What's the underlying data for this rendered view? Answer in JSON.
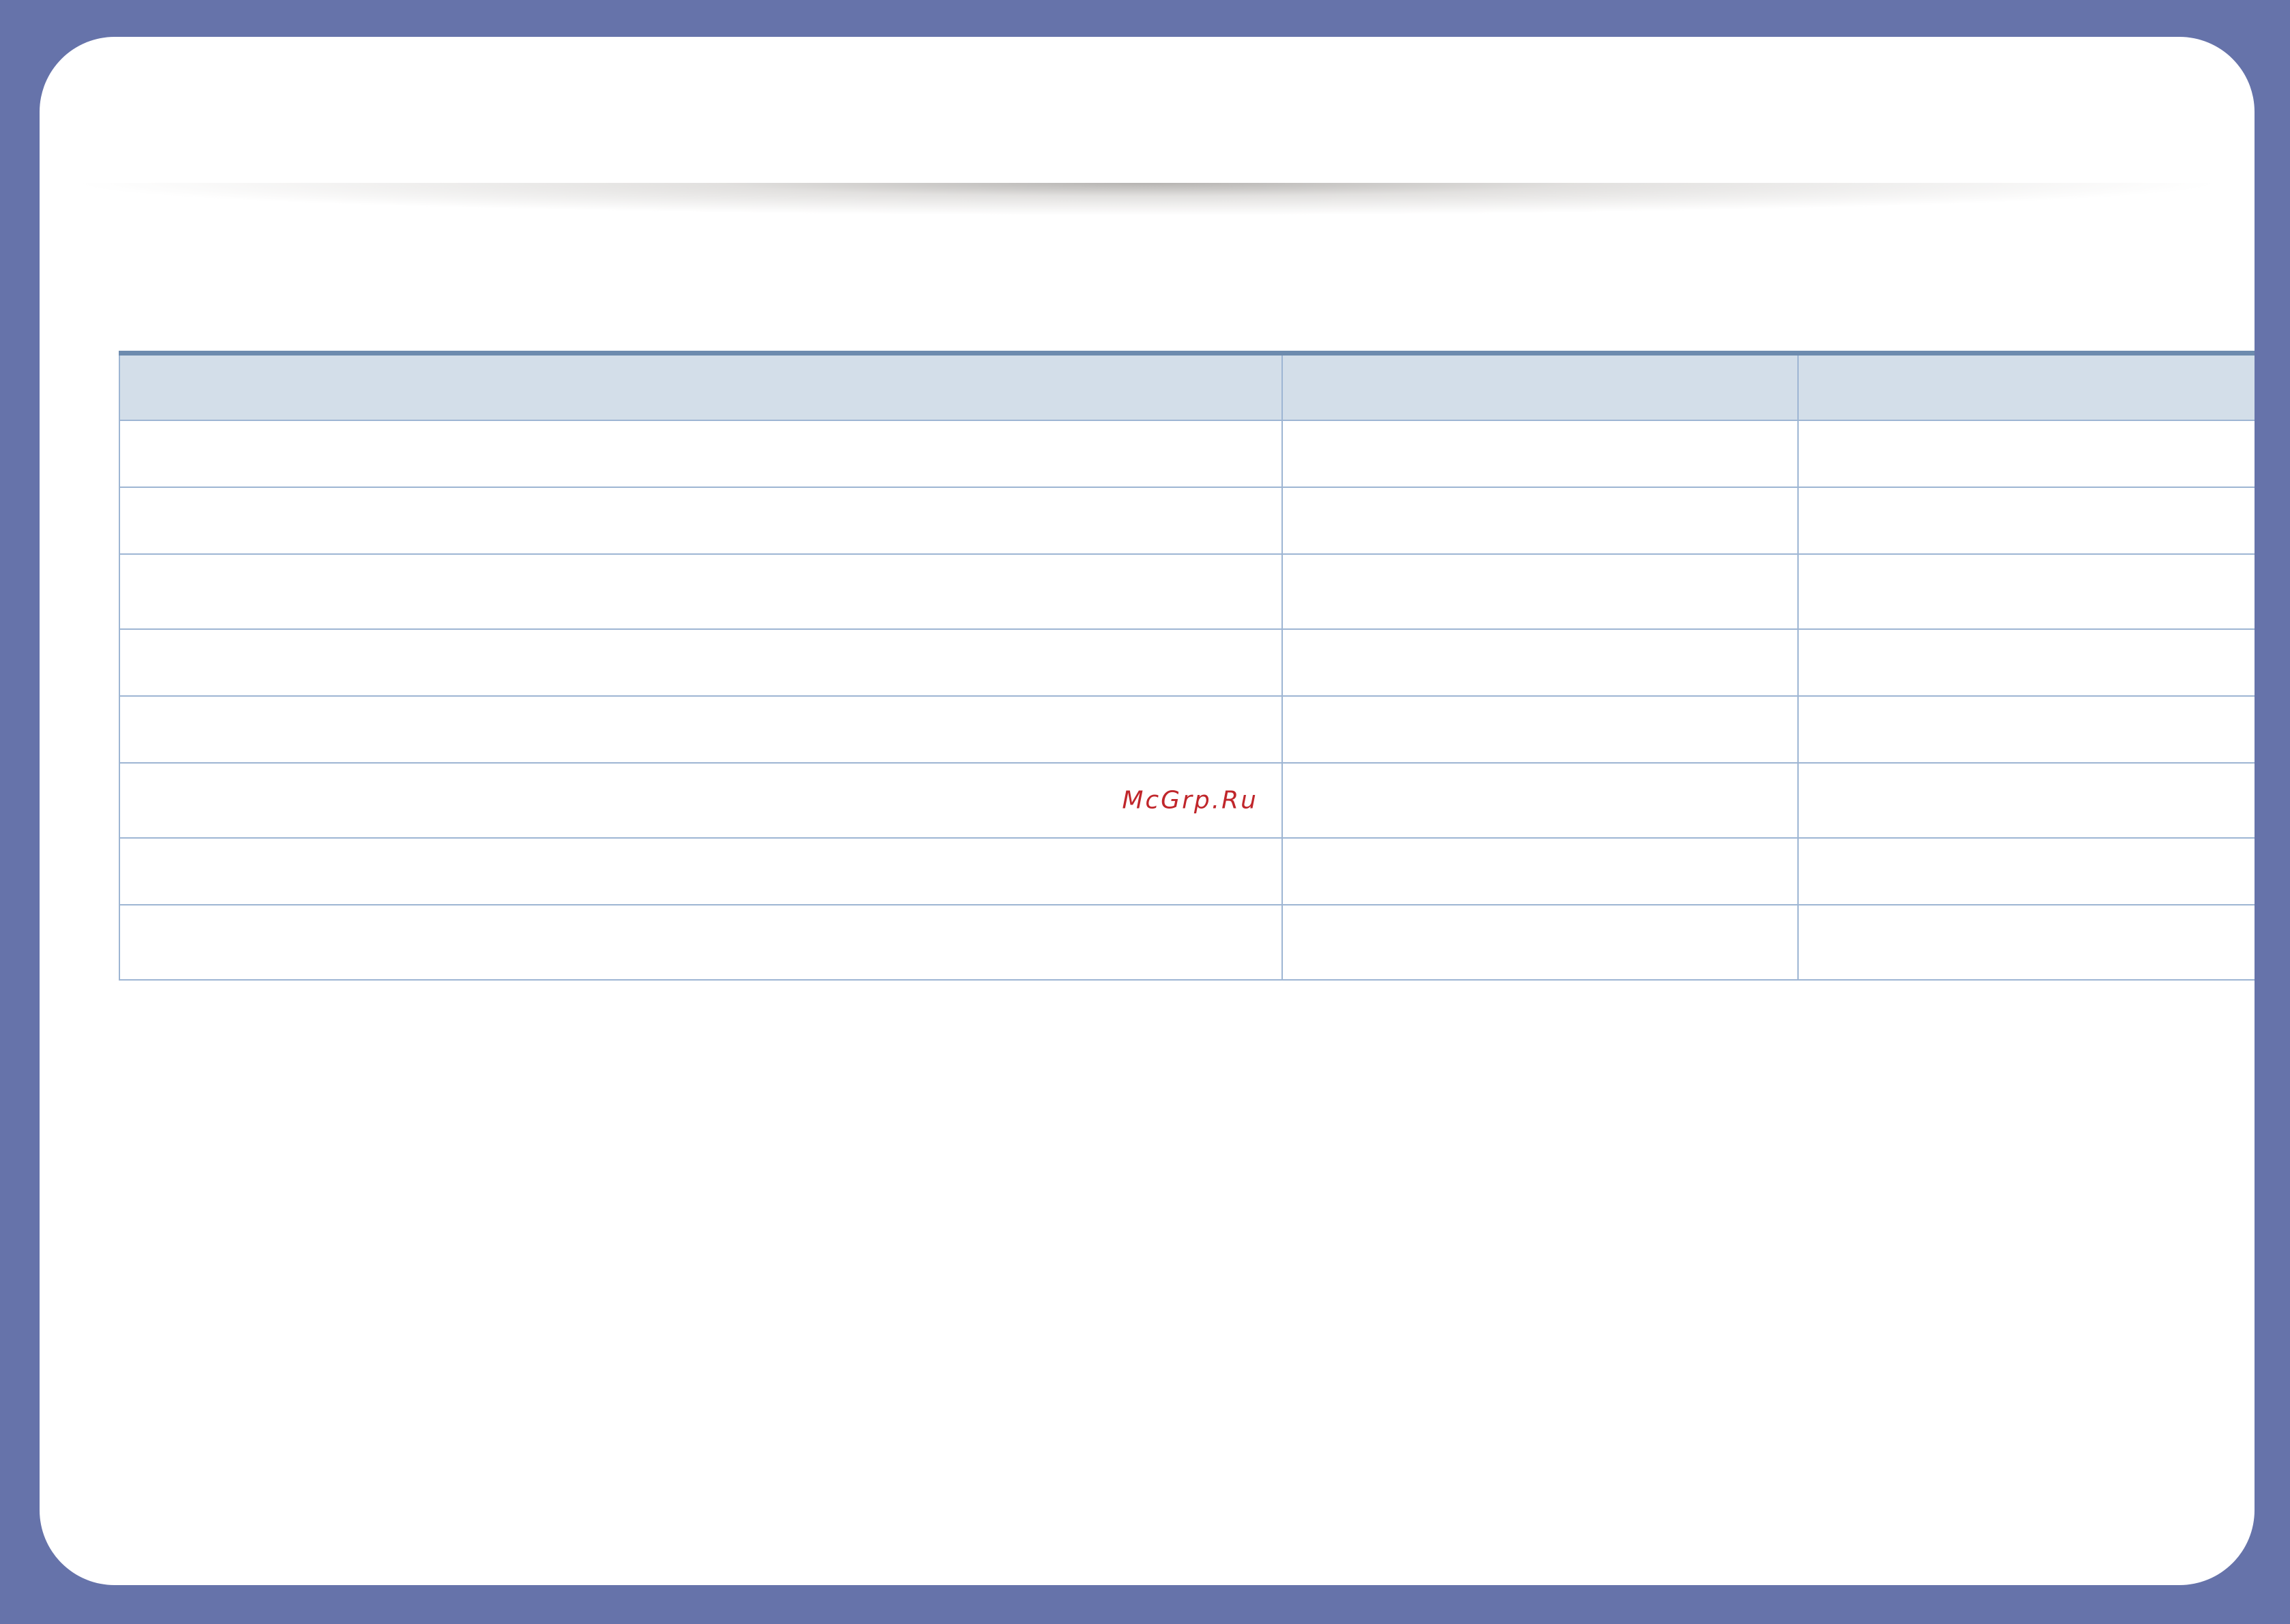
{
  "watermark": "McGrp.Ru",
  "table": {
    "header": [
      "",
      "",
      ""
    ],
    "rows": [
      [
        "",
        "",
        ""
      ],
      [
        "",
        "",
        ""
      ],
      [
        "",
        "",
        ""
      ],
      [
        "",
        "",
        ""
      ],
      [
        "",
        "",
        ""
      ],
      [
        "",
        "",
        ""
      ],
      [
        "",
        "",
        ""
      ],
      [
        "",
        "",
        ""
      ]
    ]
  }
}
